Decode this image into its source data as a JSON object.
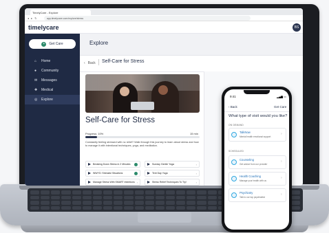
{
  "browser": {
    "tab_title": "TimelyCare - Explore",
    "url": "app.timelycare.com/explore/stress"
  },
  "app": {
    "logo_text": "timelycare",
    "avatar_initials": "BS"
  },
  "sidebar": {
    "get_care": "Get Care",
    "items": [
      {
        "label": "Home",
        "icon": "home-icon"
      },
      {
        "label": "Community",
        "icon": "community-icon"
      },
      {
        "label": "Messages",
        "icon": "messages-icon"
      },
      {
        "label": "Medical",
        "icon": "medical-icon"
      },
      {
        "label": "Explore",
        "icon": "explore-icon",
        "active": true
      }
    ]
  },
  "main": {
    "section_title": "Explore",
    "back_label": "Back",
    "page_title": "Self-Care for Stress",
    "heading": "Self-Care for Stress",
    "progress_label": "Progress: 10%",
    "progress_value": 0.1,
    "progress_time": "15 min",
    "description": "Constantly feeling stressed with no relief? Walk through this journey to learn about stress and how to manage it with intentional techniques, yoga, and meditation.",
    "items": [
      {
        "label": "Breaking Down Stress in 2 Minutes",
        "done": true
      },
      {
        "label": "Sunday Gentle Yoga",
        "done": false
      },
      {
        "label": "WWYD: Stressful Situations",
        "done": true
      },
      {
        "label": "Tent Day Yoga",
        "done": false
      },
      {
        "label": "Manage Stress With SMART Intentions",
        "done": false
      },
      {
        "label": "Stress Relief Techniques To Try!",
        "done": false
      }
    ]
  },
  "phone": {
    "time": "9:41",
    "back_label": "Back",
    "get_care": "Get Care",
    "question": "What type of visit would you like?",
    "on_demand_label": "ON DEMAND",
    "scheduled_label": "SCHEDULED",
    "on_demand": [
      {
        "title": "TalkNow",
        "subtitle": "Mental health emotional support"
      }
    ],
    "scheduled": [
      {
        "title": "Counseling",
        "subtitle": "Get advice from our provider"
      },
      {
        "title": "Health Coaching",
        "subtitle": "Manage your health with us"
      },
      {
        "title": "Psychiatry",
        "subtitle": "Talk to our top psychiatrist"
      }
    ]
  }
}
